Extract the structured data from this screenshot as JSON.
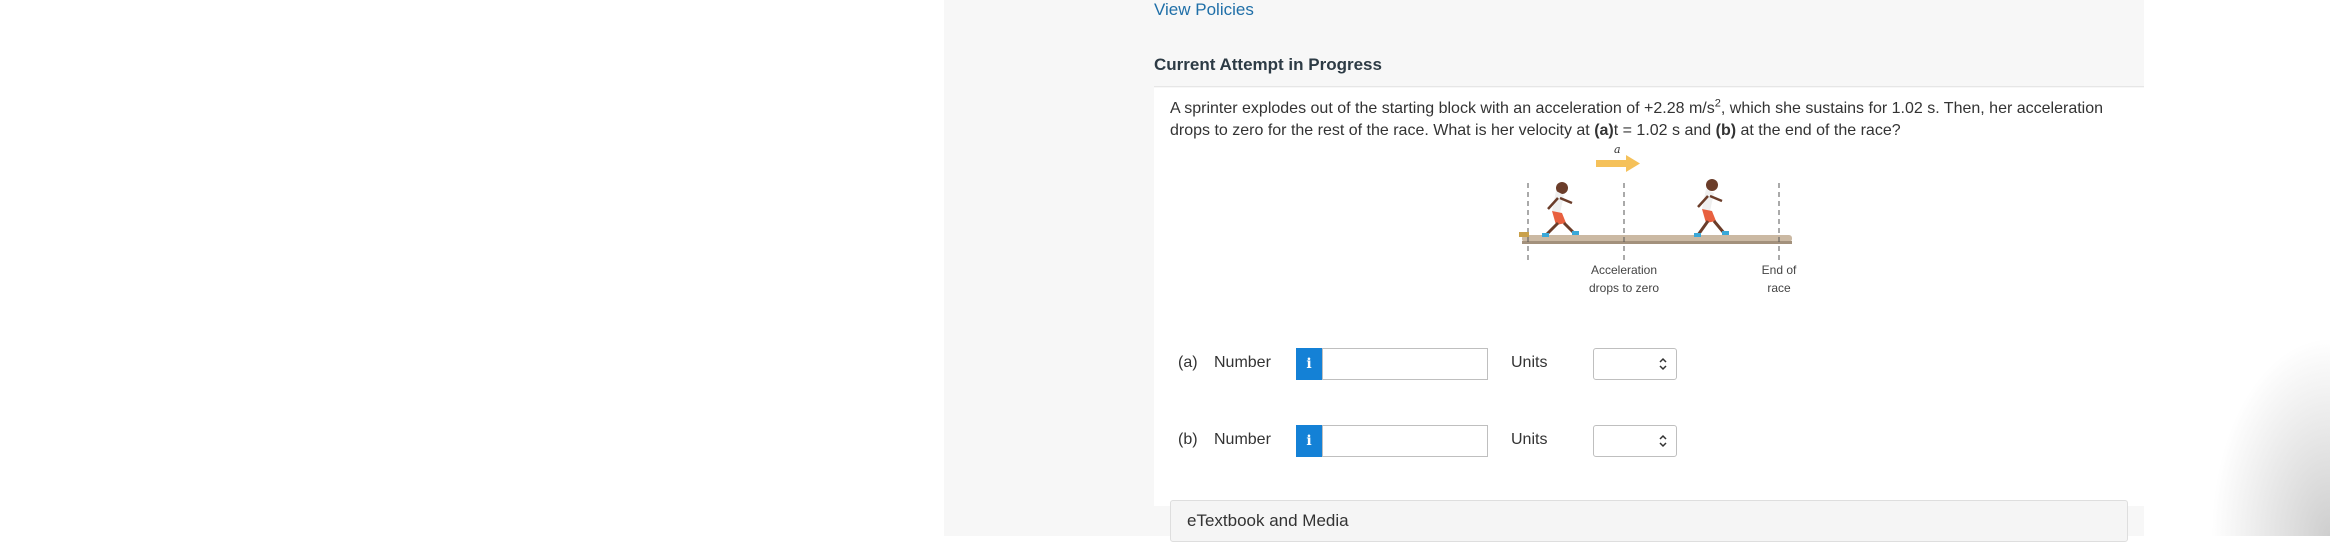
{
  "links": {
    "view_policies": "View Policies"
  },
  "attempt": {
    "title": "Current Attempt in Progress"
  },
  "question": {
    "text_1": "A sprinter explodes out of the starting block with an acceleration of +2.28 m/s",
    "sup": "2",
    "text_2": ", which she sustains for 1.02 s. Then, her acceleration drops to zero for the rest of the race. What is her velocity at ",
    "part_a_bold": "(a)",
    "text_3": "t = 1.02 s and ",
    "part_b_bold": "(b)",
    "text_4": " at the end of the race?"
  },
  "figure": {
    "accel_label": "a",
    "label_drops_line1": "Acceleration",
    "label_drops_line2": "drops to zero",
    "label_end_line1": "End of",
    "label_end_line2": "race",
    "colors": {
      "arrow": "#f5c15a",
      "track": "#cbb9a3",
      "runner_skin": "#6b3d2a",
      "runner_shorts": "#e8603f",
      "runner_shoes": "#3aa8d8"
    }
  },
  "answers": [
    {
      "part": "(a)",
      "number_label": "Number",
      "info_icon": "i",
      "value": "",
      "units_label": "Units",
      "units_value": ""
    },
    {
      "part": "(b)",
      "number_label": "Number",
      "info_icon": "i",
      "value": "",
      "units_label": "Units",
      "units_value": ""
    }
  ],
  "etextbook": {
    "label": "eTextbook and Media"
  },
  "colors": {
    "link": "#1f6fa8",
    "info_button": "#1481d6"
  }
}
